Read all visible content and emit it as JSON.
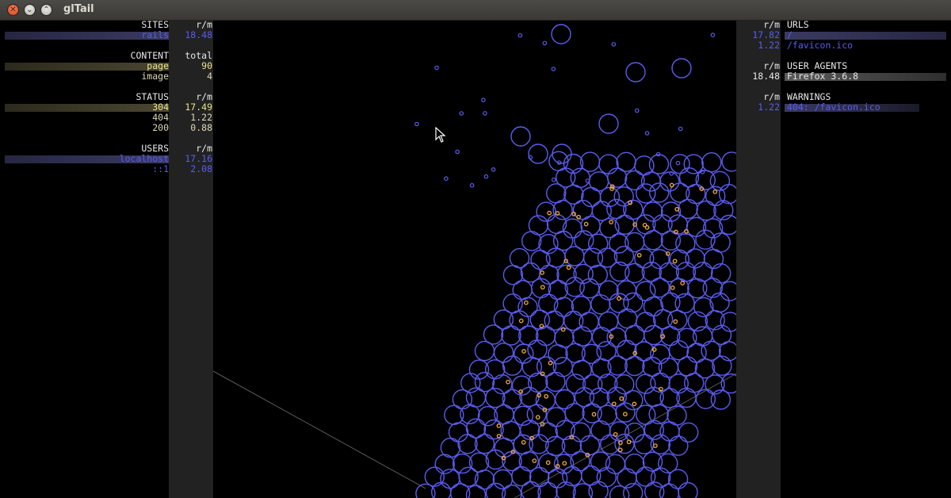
{
  "window": {
    "title": "glTail"
  },
  "sites": {
    "heading": "SITES",
    "unit": "r/m",
    "rows": [
      {
        "name": "rails",
        "value": "18.48"
      }
    ]
  },
  "content": {
    "heading": "CONTENT",
    "unit": "total",
    "rows": [
      {
        "name": "page",
        "value": "90"
      },
      {
        "name": "image",
        "value": "4"
      }
    ]
  },
  "status": {
    "heading": "STATUS",
    "unit": "r/m",
    "rows": [
      {
        "name": "304",
        "value": "17.49"
      },
      {
        "name": "404",
        "value": "1.22"
      },
      {
        "name": "200",
        "value": "0.88"
      }
    ]
  },
  "users": {
    "heading": "USERS",
    "unit": "r/m",
    "rows": [
      {
        "name": "localhost",
        "value": "17.16"
      },
      {
        "name": "::1",
        "value": "2.08"
      }
    ]
  },
  "urls": {
    "heading": "URLS",
    "unit": "r/m",
    "rows": [
      {
        "value": "17.82",
        "name": "/"
      },
      {
        "value": "1.22",
        "name": "/favicon.ico"
      }
    ]
  },
  "user_agents": {
    "heading": "USER AGENTS",
    "unit": "r/m",
    "rows": [
      {
        "value": "18.48",
        "name": "Firefox 3.6.8"
      }
    ]
  },
  "warnings": {
    "heading": "WARNINGS",
    "unit": "r/m",
    "rows": [
      {
        "value": "1.22",
        "name": "404: /favicon.ico"
      }
    ]
  },
  "colors": {
    "blue": "#5a5cf0",
    "yellow": "#e8e48a",
    "orange": "#f2a83c",
    "background": "#000000"
  },
  "icons": {
    "close": "close-icon",
    "minimize": "minimize-icon",
    "maximize": "maximize-icon",
    "cursor": "mouse-pointer-icon"
  }
}
